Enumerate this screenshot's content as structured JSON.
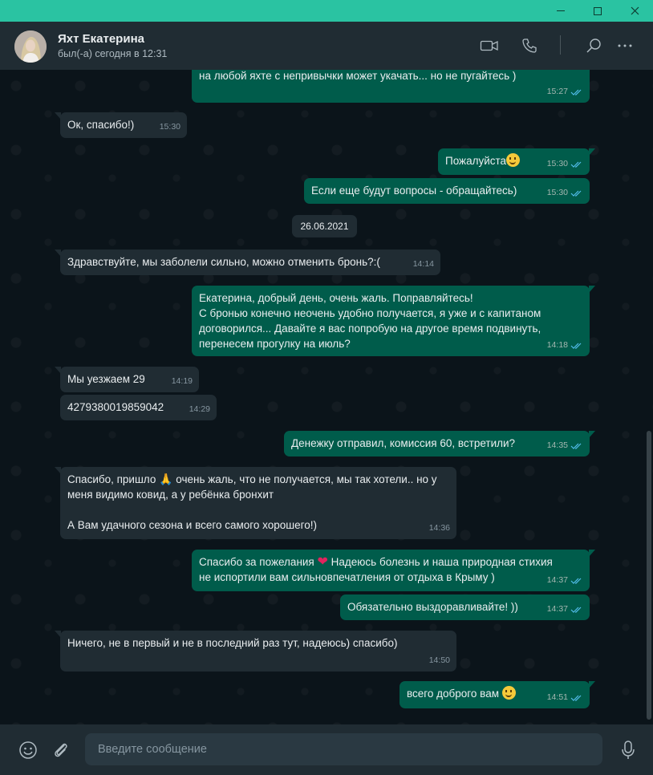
{
  "window": {
    "controls": [
      "minimize-icon",
      "maximize-icon",
      "close-icon"
    ]
  },
  "header": {
    "name": "Яхт Екатерина",
    "status": "был(-а) сегодня в 12:31",
    "icons": [
      "video-call-icon",
      "voice-call-icon",
      "search-icon",
      "more-icon"
    ]
  },
  "colors": {
    "accent": "#2ac3a2",
    "out_bubble": "#005c4b",
    "in_bubble": "#202c33",
    "read_tick": "#53bdeb"
  },
  "messages": [
    {
      "dir": "out",
      "text": "на любой яхте с непривычки может укачать... но не пугайтесь )",
      "time": "15:27",
      "read": true
    },
    {
      "dir": "in",
      "text": "Ок, спасибо!)",
      "time": "15:30"
    },
    {
      "dir": "out",
      "text": "Пожалуйста",
      "emoji": "smile",
      "time": "15:30",
      "read": true
    },
    {
      "dir": "out",
      "text": "Если еще будут вопросы - обращайтесь)",
      "time": "15:30",
      "read": true
    },
    {
      "dir": "in",
      "text": "Здравствуйте, мы заболели сильно, можно отменить бронь?:(",
      "time": "14:14"
    },
    {
      "dir": "out",
      "text": "Екатерина, добрый день, очень жаль. Поправляйтесь!\nС бронью конечно неочень удобно получается, я уже и с капитаном\nдоговорился... Давайте я вас попробую на другое время подвинуть,\nперенесем прогулку на июль?",
      "time": "14:18",
      "read": true
    },
    {
      "dir": "in",
      "text": "Мы уезжаем 29",
      "time": "14:19"
    },
    {
      "dir": "in",
      "text": "4279380019859042",
      "time": "14:29"
    },
    {
      "dir": "out",
      "text": "Денежку отправил, комиссия 60, встретили?",
      "time": "14:35",
      "read": true
    },
    {
      "dir": "in",
      "text_a": "Спасибо, пришло ",
      "emoji": "pray",
      "text_b": " очень жаль, что не получается, мы так хотели.. но у\nменя видимо ковид, а у ребёнка бронхит\n\nА Вам удачного сезона и всего самого хорошего!)",
      "time": "14:36"
    },
    {
      "dir": "out",
      "text_a": "Спасибо за пожелания ",
      "emoji": "heart",
      "text_b": " Надеюсь болезнь и наша природная стихия\nне испортили вам сильновпечатления от отдыха в Крыму )",
      "time": "14:37",
      "read": true
    },
    {
      "dir": "out",
      "text": "Обязательно выздоравливайте! ))",
      "time": "14:37",
      "read": true
    },
    {
      "dir": "in",
      "text": "Ничего, не в первый и не в последний раз тут, надеюсь) спасибо)",
      "time": "14:50"
    },
    {
      "dir": "out",
      "text": "всего доброго вам ",
      "emoji": "smile",
      "time": "14:51",
      "read": true
    }
  ],
  "date_divider": "26.06.2021",
  "composer": {
    "placeholder": "Введите сообщение",
    "icons": [
      "emoji-icon",
      "attach-icon",
      "microphone-icon"
    ]
  }
}
